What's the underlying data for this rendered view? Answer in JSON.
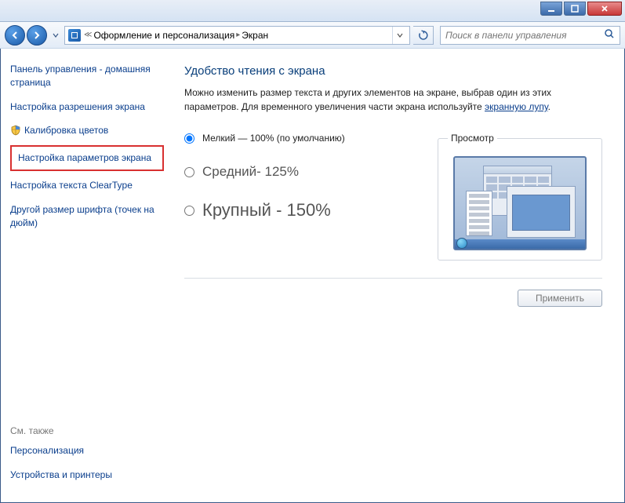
{
  "breadcrumb": {
    "part1": "Оформление и персонализация",
    "part2": "Экран"
  },
  "search": {
    "placeholder": "Поиск в панели управления"
  },
  "sidebar": {
    "home": "Панель управления - домашняя страница",
    "resolution": "Настройка разрешения экрана",
    "calibration": "Калибровка цветов",
    "display_params": "Настройка параметров экрана",
    "cleartype": "Настройка текста ClearType",
    "font_size": "Другой размер шрифта (точек на дюйм)",
    "see_also": "См. также",
    "personalization": "Персонализация",
    "devices": "Устройства и принтеры"
  },
  "main": {
    "title": "Удобство чтения с экрана",
    "desc1": "Можно изменить размер текста и других элементов на экране, выбрав один из этих параметров. Для временного увеличения части экрана используйте ",
    "magnifier_link": "экранную лупу",
    "option_small": "Мелкий — 100% (по умолчанию)",
    "option_medium": "Средний- 125%",
    "option_large": "Крупный - 150%",
    "preview_label": "Просмотр",
    "apply": "Применить"
  }
}
